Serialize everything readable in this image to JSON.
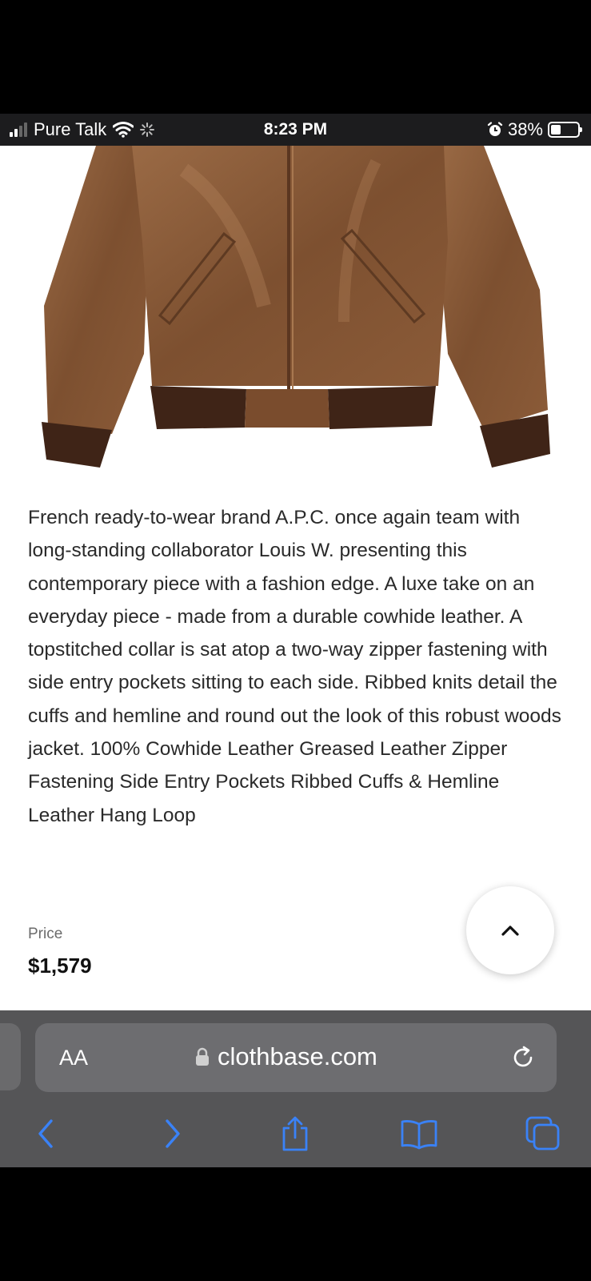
{
  "status_bar": {
    "carrier": "Pure Talk",
    "time": "8:23 PM",
    "battery_percent": "38%",
    "battery_level": 0.38
  },
  "product_image": {
    "icon": "leather-jacket-photo",
    "colors": {
      "leather": "#8a5a38",
      "rib": "#3f2417"
    }
  },
  "product": {
    "description": "French ready-to-wear brand A.P.C. once again team with long-standing collaborator Louis W. presenting this contemporary piece with a fashion edge. A luxe take on an everyday piece - made from a durable cowhide leather. A topstitched collar is sat atop a two-way zipper fastening with side entry pockets sitting to each side. Ribbed knits detail the cuffs and hemline and round out the look of this robust woods jacket. 100% Cowhide Leather Greased Leather Zipper Fastening Side Entry Pockets Ribbed Cuffs & Hemline Leather Hang Loop",
    "price_label": "Price",
    "price": "$1,579"
  },
  "scroll_top_button": {
    "icon": "chevron-up-icon"
  },
  "browser": {
    "text_size_label": "AA",
    "url": "clothbase.com",
    "accent": "#3a82f7",
    "toolbar": [
      "back-icon",
      "forward-icon",
      "share-icon",
      "bookmarks-icon",
      "tabs-icon"
    ]
  }
}
